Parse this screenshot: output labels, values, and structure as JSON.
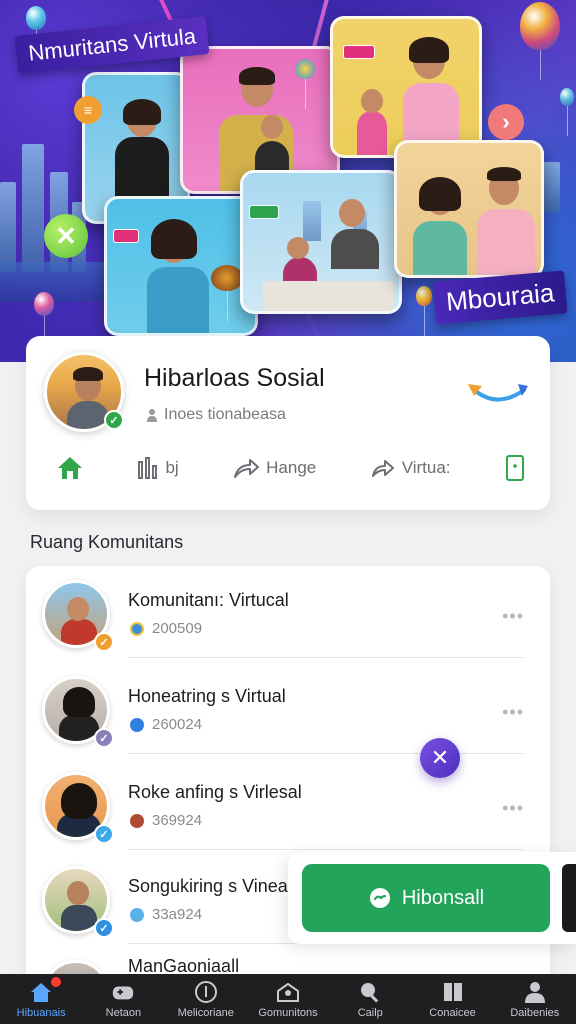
{
  "hero": {
    "banner_top_left": "Nmuritans Virtula",
    "banner_bottom_right": "Mbouraia"
  },
  "profile": {
    "name": "Hibarloas Sosial",
    "subtitle": "Inoes tionabeasa",
    "actions": [
      {
        "label": "",
        "icon": "home-icon"
      },
      {
        "label": "bj",
        "icon": "bar-chart-icon"
      },
      {
        "label": "Hange",
        "icon": "share-arrow-icon"
      },
      {
        "label": "Virtua:",
        "icon": "forward-arrow-icon"
      },
      {
        "label": "",
        "icon": "phone-icon"
      }
    ]
  },
  "section": {
    "title": "Ruang Komunitans"
  },
  "communities": [
    {
      "title": "Komunitanı: Virtucal",
      "count": "200509",
      "badge_color": "#f0a030",
      "dot_color": "#3a8fd8"
    },
    {
      "title": "Honeatring s Virtual",
      "count": "260024",
      "badge_color": "#8a7fb8",
      "dot_color": "#2f7fe0"
    },
    {
      "title": "Roke anfing s Virlesal",
      "count": "369924",
      "badge_color": "#3fa8e8",
      "dot_color": "#b04a30"
    },
    {
      "title": "Songukiring s Vineasi",
      "count": "33a924",
      "badge_color": "#2f8fe0",
      "dot_color": "#5ab0e8"
    },
    {
      "title": "ManGaoniaall",
      "count": "",
      "badge_color": "#2f8fe0",
      "dot_color": "#5ab0e8"
    }
  ],
  "more_label": "•••",
  "cta": {
    "label": "Hibonsall"
  },
  "nav": [
    {
      "label": "Hibuanais",
      "icon": "home-icon",
      "active": true
    },
    {
      "label": "Netaon",
      "icon": "gamepad-icon",
      "active": false
    },
    {
      "label": "Melicoriane",
      "icon": "info-circle-icon",
      "active": false
    },
    {
      "label": "Gomunitons",
      "icon": "community-icon",
      "active": false
    },
    {
      "label": "Cailp",
      "icon": "search-icon",
      "active": false
    },
    {
      "label": "Conaicee",
      "icon": "book-icon",
      "active": false
    },
    {
      "label": "Daibenies",
      "icon": "profile-icon",
      "active": false
    }
  ],
  "colors": {
    "accent_green": "#22a55a",
    "nav_active": "#5aa6ff",
    "hero_purple": "#3e2ab0"
  }
}
